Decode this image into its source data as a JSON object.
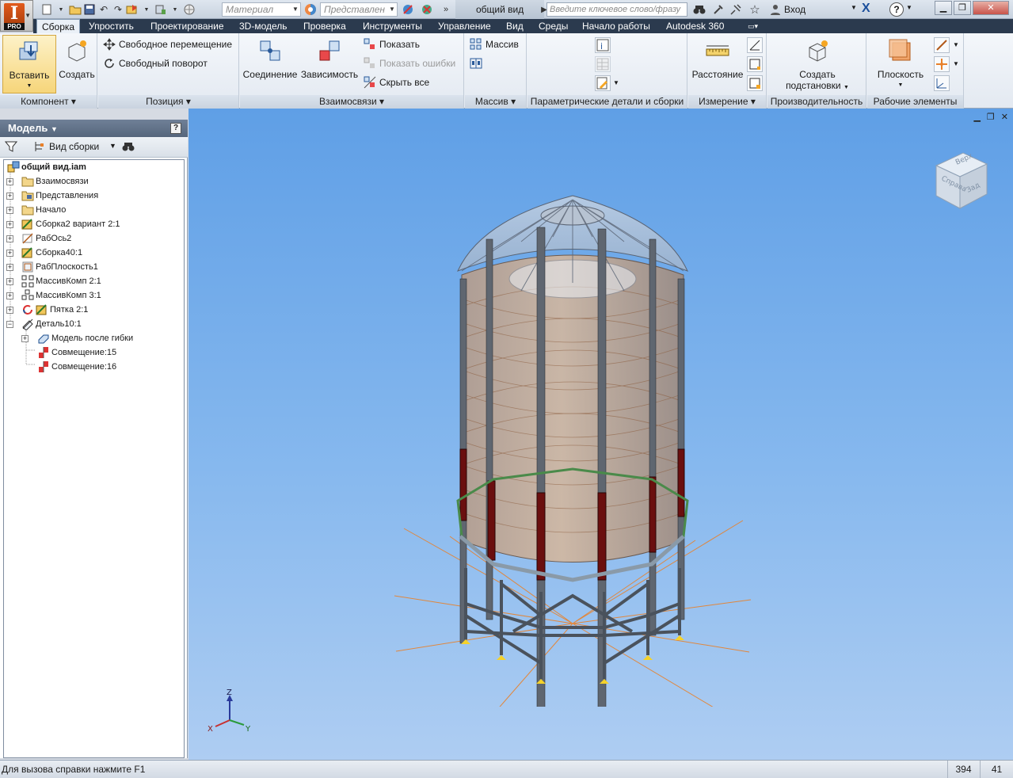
{
  "app": {
    "logo_letter": "I",
    "logo_sub": "PRO",
    "doc_title": "общий вид"
  },
  "quick_access": {
    "material_placeholder": "Материал",
    "view_rep_placeholder": "Представлен",
    "search_placeholder": "Введите ключевое слово/фразу",
    "signin_label": "Вход"
  },
  "tabs": [
    "Сборка",
    "Упростить",
    "Проектирование",
    "3D-модель",
    "Проверка",
    "Инструменты",
    "Управление",
    "Вид",
    "Среды",
    "Начало работы",
    "Autodesk 360"
  ],
  "ribbon": {
    "component": {
      "label": "Компонент",
      "insert": "Вставить",
      "create": "Создать"
    },
    "position": {
      "label": "Позиция",
      "free_move": "Свободное перемещение",
      "free_rotate": "Свободный поворот"
    },
    "relations": {
      "label": "Взаимосвязи",
      "joint": "Соединение",
      "constraint": "Зависимость",
      "show": "Показать",
      "show_errors": "Показать ошибки",
      "hide_all": "Скрыть все"
    },
    "pattern": {
      "label": "Массив",
      "pattern_btn": "Массив"
    },
    "productivity_params": {
      "label": "Параметрические детали и сборки"
    },
    "measure": {
      "label": "Измерение",
      "distance": "Расстояние"
    },
    "productivity": {
      "label": "Производительность",
      "create_sub_line1": "Создать",
      "create_sub_line2": "подстановки"
    },
    "work_features": {
      "label": "Рабочие элементы",
      "plane": "Плоскость"
    }
  },
  "browser": {
    "title": "Модель",
    "view_label": "Вид сборки",
    "tree": [
      {
        "label": "общий вид.iam",
        "icon": "assembly-icon",
        "bold": true
      },
      {
        "label": "Взаимосвязи",
        "icon": "folder-icon"
      },
      {
        "label": "Представления",
        "icon": "representations-icon"
      },
      {
        "label": "Начало",
        "icon": "folder-icon"
      },
      {
        "label": "Сборка2 вариант 2:1",
        "icon": "subassembly-icon"
      },
      {
        "label": "РабОсь2",
        "icon": "work-axis-icon"
      },
      {
        "label": "Сборка40:1",
        "icon": "subassembly-icon"
      },
      {
        "label": "РабПлоскость1",
        "icon": "work-plane-icon"
      },
      {
        "label": "МассивКомп 2:1",
        "icon": "pattern-icon"
      },
      {
        "label": "МассивКомп 3:1",
        "icon": "pattern-icon"
      },
      {
        "label": "Пятка 2:1",
        "icon": "subassembly-icon"
      },
      {
        "label": "Деталь10:1",
        "icon": "sheetmetal-icon"
      },
      {
        "label": "Модель после гибки",
        "icon": "flat-model-icon"
      },
      {
        "label": "Совмещение:15",
        "icon": "mate-constraint-icon"
      },
      {
        "label": "Совмещение:16",
        "icon": "mate-constraint-icon"
      }
    ]
  },
  "viewcube": {
    "top": "Верх",
    "front": "Справа",
    "right": "Зад"
  },
  "triad": {
    "x": "X",
    "y": "Y",
    "z": "Z"
  },
  "status": {
    "text": "Для вызова справки нажмите F1",
    "x": "394",
    "y": "41"
  },
  "colors": {
    "tabs_bg": "#2b3a4e",
    "viewport_top": "#5f9fe6",
    "viewport_bottom": "#aecdf2",
    "accent_orange": "#e8812a"
  }
}
